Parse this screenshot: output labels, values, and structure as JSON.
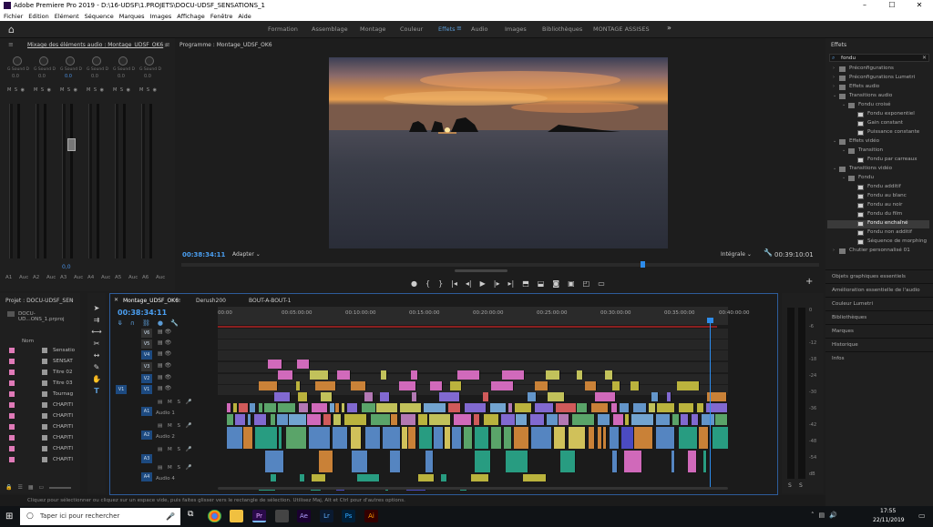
{
  "window": {
    "title": "Adobe Premiere Pro 2019 - D:\\16-UDSF\\1.PROJETS\\DOCU-UDSF_SENSATIONS_1",
    "controls": [
      "–",
      "☐",
      "✕"
    ]
  },
  "menu": [
    "Fichier",
    "Edition",
    "Elément",
    "Séquence",
    "Marques",
    "Images",
    "Affichage",
    "Fenêtre",
    "Aide"
  ],
  "workspaces": [
    "Formation",
    "Assemblage",
    "Montage",
    "Couleur",
    "Effets",
    "Audio",
    "Images",
    "Bibliothèques",
    "MONTAGE ASSISES"
  ],
  "active_workspace": "Effets",
  "mixer": {
    "tab": "Mixage des éléments audio : Montage_UDSF_OK6",
    "channel_labels": [
      "G Sound D",
      "G Sound D",
      "G Sound D",
      "G Sound D",
      "G Sound D",
      "G Sound D"
    ],
    "channel_values": [
      "0.0",
      "0.0",
      "0.0",
      "0.0",
      "0.0",
      "0.0"
    ],
    "master_value": "0,0",
    "channel_names": [
      "A1",
      "Auc",
      "A2",
      "Auc",
      "A3",
      "Auc",
      "A4",
      "Auc",
      "A5",
      "Auc",
      "A6",
      "Auc"
    ]
  },
  "program": {
    "tab": "Programme : Montage_UDSF_OK6",
    "timecode": "00:38:34:11",
    "fit": "Adapter",
    "quality": "Intégrale",
    "duration": "00:39:10:01"
  },
  "effects": {
    "title": "Effets",
    "search": "fondu",
    "tree": [
      {
        "label": "Préconfigurations",
        "level": 0,
        "type": "folder"
      },
      {
        "label": "Préconfigurations Lumetri",
        "level": 0,
        "type": "folder"
      },
      {
        "label": "Effets audio",
        "level": 0,
        "type": "folder"
      },
      {
        "label": "Transitions audio",
        "level": 0,
        "type": "folder"
      },
      {
        "label": "Fondu croisé",
        "level": 1,
        "type": "folder"
      },
      {
        "label": "Fondu exponentiel",
        "level": 2,
        "type": "effect"
      },
      {
        "label": "Gain constant",
        "level": 2,
        "type": "effect"
      },
      {
        "label": "Puissance constante",
        "level": 2,
        "type": "effect"
      },
      {
        "label": "Effets vidéo",
        "level": 0,
        "type": "folder"
      },
      {
        "label": "Transition",
        "level": 1,
        "type": "folder"
      },
      {
        "label": "Fondu par carreaux",
        "level": 2,
        "type": "effect"
      },
      {
        "label": "Transitions vidéo",
        "level": 0,
        "type": "folder"
      },
      {
        "label": "Fondu",
        "level": 1,
        "type": "folder"
      },
      {
        "label": "Fondu additif",
        "level": 2,
        "type": "effect"
      },
      {
        "label": "Fondu au blanc",
        "level": 2,
        "type": "effect"
      },
      {
        "label": "Fondu au noir",
        "level": 2,
        "type": "effect"
      },
      {
        "label": "Fondu du film",
        "level": 2,
        "type": "effect"
      },
      {
        "label": "Fondu enchaîné",
        "level": 2,
        "type": "effect"
      },
      {
        "label": "Fondu non additif",
        "level": 2,
        "type": "effect"
      },
      {
        "label": "Séquence de morphing",
        "level": 2,
        "type": "effect"
      },
      {
        "label": "Chutier personnalisé 01",
        "level": 0,
        "type": "folder"
      }
    ],
    "selected": "Fondu enchaîné",
    "sections": [
      "Objets graphiques essentiels",
      "Amélioration essentielle de l'audio",
      "Couleur Lumetri",
      "Bibliothèques",
      "Marques",
      "Historique",
      "Infos"
    ]
  },
  "project": {
    "tab": "Projet : DOCU-UDSF_SEN",
    "file": "DOCU-UD...ONS_1.prproj",
    "column": "Nom",
    "items": [
      "Sensatio",
      "SENSAT",
      "Titre 02",
      "Titre 03",
      "Tournag",
      "CHAPITI",
      "CHAPITI",
      "CHAPITI",
      "CHAPITI",
      "CHAPITI",
      "CHAPITI"
    ]
  },
  "timeline": {
    "tabs": [
      "Montage_UDSF_OK6",
      "Derush200",
      "BOUT-A-BOUT-1"
    ],
    "timecode": "00:38:34:11",
    "ruler": [
      "00:00",
      "00:05:00:00",
      "00:10:00:00",
      "00:15:00:00",
      "00:20:00:00",
      "00:25:00:00",
      "00:30:00:00",
      "00:35:00:00",
      "00:40:00:00"
    ],
    "video_tracks": [
      "V6",
      "V5",
      "V4",
      "V3",
      "V2",
      "V1"
    ],
    "audio_tracks": [
      {
        "id": "A1",
        "name": "Audio 1"
      },
      {
        "id": "A2",
        "name": "Audio 2"
      },
      {
        "id": "A3",
        "name": ""
      },
      {
        "id": "A4",
        "name": "Audio 4"
      }
    ],
    "src_v": "V1",
    "track_buttons": [
      "M",
      "S"
    ]
  },
  "meter_scale": [
    "0",
    "-6",
    "-12",
    "-18",
    "-24",
    "-30",
    "-36",
    "-42",
    "-48",
    "-54",
    "dB"
  ],
  "meter_solo": [
    "S",
    "S"
  ],
  "status": "Cliquez pour sélectionner ou cliquez sur un espace vide, puis faites glisser vers le rectangle de sélection. Utilisez Maj, Alt et Ctrl pour d'autres options.",
  "taskbar": {
    "search": "Taper ici pour rechercher",
    "time": "17:55",
    "date": "22/11/2019",
    "apps": [
      "Pr",
      "Ae",
      "Lr",
      "Ps",
      "Ai"
    ]
  },
  "colors": {
    "accent": "#2d8ceb",
    "premiere": "#2a0a4a",
    "playhead": "#2d8ceb"
  }
}
